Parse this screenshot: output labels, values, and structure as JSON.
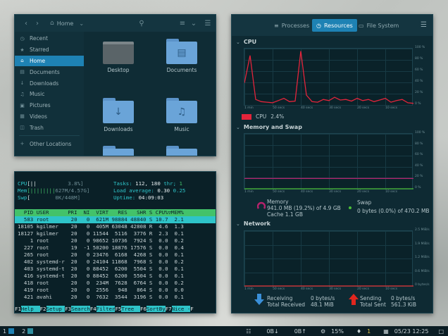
{
  "file_manager": {
    "path": "Home",
    "sidebar": [
      {
        "label": "Recent",
        "icon": "clock-icon"
      },
      {
        "label": "Starred",
        "icon": "star-icon"
      },
      {
        "label": "Home",
        "icon": "home-icon",
        "active": true
      },
      {
        "label": "Documents",
        "icon": "document-icon"
      },
      {
        "label": "Downloads",
        "icon": "download-icon"
      },
      {
        "label": "Music",
        "icon": "music-icon"
      },
      {
        "label": "Pictures",
        "icon": "picture-icon"
      },
      {
        "label": "Videos",
        "icon": "video-icon"
      },
      {
        "label": "Trash",
        "icon": "trash-icon"
      },
      {
        "label": "Other Locations",
        "icon": "plus-icon"
      }
    ],
    "folders": [
      "Desktop",
      "Documents",
      "Downloads",
      "Music",
      "",
      ""
    ]
  },
  "htop": {
    "cpu_label": "CPU",
    "cpu_bar": "[||",
    "cpu_value": "3.8%]",
    "mem_label": "Mem",
    "mem_bar": "[||||||||",
    "mem_value": "627M/4.57G]",
    "swp_label": "Swp",
    "swp_bar": "[",
    "swp_value": "0K/448M]",
    "tasks_label": "Tasks:",
    "tasks_value": "112,",
    "thr_value": "180",
    "thr_label": "thr;",
    "running_value": "1",
    "load_label": "Load average:",
    "load_1": "0.30",
    "load_5": "0.25",
    "uptime_label": "Uptime:",
    "uptime_value": "04:09:03",
    "header": "  PID USER      PRI  NI  VIRT   RES   SHR S CPU%▽MEM%",
    "rows": [
      "  583 root       20   0  621M 98884 48840 S 10.7  2.1",
      "18105 kgilmer    20   0  405M 63048 42808 R  4.6  1.3",
      "18127 kgilmer    20   0 11544  5116  3776 R  2.3  0.1",
      "    1 root       20   0 98652 10736  7924 S  0.0  0.2",
      "  227 root       19  -1 50200 18876 17576 S  0.0  0.4",
      "  265 root       20   0 23476  6168  4268 S  0.0  0.1",
      "  402 systemd-r  20   0 24104 11868  7968 S  0.0  0.2",
      "  403 systemd-t  20   0 88452  6200  5504 S  0.0  0.1",
      "  416 systemd-t  20   0 88452  6200  5504 S  0.0  0.1",
      "  418 root       20   0  234M  7628  6764 S  0.0  0.2",
      "  419 root       20   0  2556   948   864 S  0.0  0.0",
      "  421 avahi      20   0  7632  3544  3196 S  0.0  0.1"
    ],
    "footer": [
      {
        "key": "F1",
        "label": "Help  "
      },
      {
        "key": "F2",
        "label": "Setup "
      },
      {
        "key": "F3",
        "label": "Search"
      },
      {
        "key": "F4",
        "label": "Filter"
      },
      {
        "key": "F5",
        "label": "Tree  "
      },
      {
        "key": "F6",
        "label": "SortBy"
      },
      {
        "key": "F7",
        "label": "Nice -"
      },
      {
        "key": "F",
        "label": ""
      }
    ]
  },
  "system_monitor": {
    "tabs": [
      {
        "label": "Processes",
        "icon": "list-icon"
      },
      {
        "label": "Resources",
        "icon": "gauge-icon",
        "active": true
      },
      {
        "label": "File System",
        "icon": "disk-icon"
      }
    ],
    "cpu_section": "CPU",
    "cpu_legend": "CPU",
    "cpu_value": "2.4%",
    "mem_section": "Memory and Swap",
    "memory_label": "Memory",
    "memory_value": "941.0 MB (19.2%) of 4.9 GB",
    "cache_value": "Cache 1.1 GB",
    "swap_label": "Swap",
    "swap_value": "0 bytes (0.0%) of 470.2 MB",
    "net_section": "Network",
    "receiving_label": "Receiving",
    "receiving_value": "0 bytes/s",
    "total_received_label": "Total Received",
    "total_received_value": "48.1 MiB",
    "sending_label": "Sending",
    "sending_value": "0 bytes/s",
    "total_sent_label": "Total Sent",
    "total_sent_value": "561.3 KiB",
    "pct_ticks": [
      "100 %",
      "80 %",
      "60 %",
      "40 %",
      "20 %",
      "0 %"
    ],
    "net_ticks": [
      "2.5 MiB/s",
      "1.9 MiB/s",
      "1.2 MiB/s",
      "0.6 MiB/s",
      "0 bytes/s"
    ],
    "time_ticks": [
      "1 min",
      "50 secs",
      "40 secs",
      "30 secs",
      "20 secs",
      "10 secs"
    ],
    "colors": {
      "cpu": "#e3243b",
      "memory": "#b5226c",
      "swap": "#4cbf38",
      "receive": "#3a8fd8",
      "send": "#e0261e"
    }
  },
  "chart_data": [
    {
      "type": "line",
      "title": "CPU",
      "x": [
        60,
        58,
        56,
        54,
        52,
        50,
        48,
        46,
        44,
        42,
        40,
        38,
        36,
        34,
        32,
        30,
        28,
        26,
        24,
        22,
        20,
        18,
        16,
        14,
        12,
        10,
        8,
        6,
        4,
        2,
        0
      ],
      "series": [
        {
          "name": "CPU",
          "values": [
            40,
            90,
            10,
            6,
            5,
            4,
            8,
            12,
            6,
            7,
            98,
            18,
            6,
            5,
            10,
            8,
            14,
            9,
            10,
            7,
            12,
            8,
            10,
            6,
            9,
            12,
            5,
            8,
            10,
            4,
            3
          ]
        }
      ],
      "ylim": [
        0,
        100
      ]
    },
    {
      "type": "line",
      "title": "Memory and Swap",
      "x": [
        60,
        0
      ],
      "series": [
        {
          "name": "Memory",
          "values": [
            19.2,
            19.2
          ]
        },
        {
          "name": "Swap",
          "values": [
            0,
            0
          ]
        }
      ],
      "ylim": [
        0,
        100
      ]
    },
    {
      "type": "line",
      "title": "Network",
      "x": [
        60,
        0
      ],
      "series": [
        {
          "name": "Receiving",
          "values": [
            0,
            0
          ]
        },
        {
          "name": "Sending",
          "values": [
            0,
            0
          ]
        }
      ],
      "ylim": [
        0,
        2.5
      ]
    }
  ],
  "taskbar": {
    "workspace_1": "1",
    "workspace_2": "2",
    "net_down": "0B↓",
    "net_up": "0B↑",
    "cpu": "15%",
    "notifications": "1",
    "datetime": "05/23 12:25"
  }
}
